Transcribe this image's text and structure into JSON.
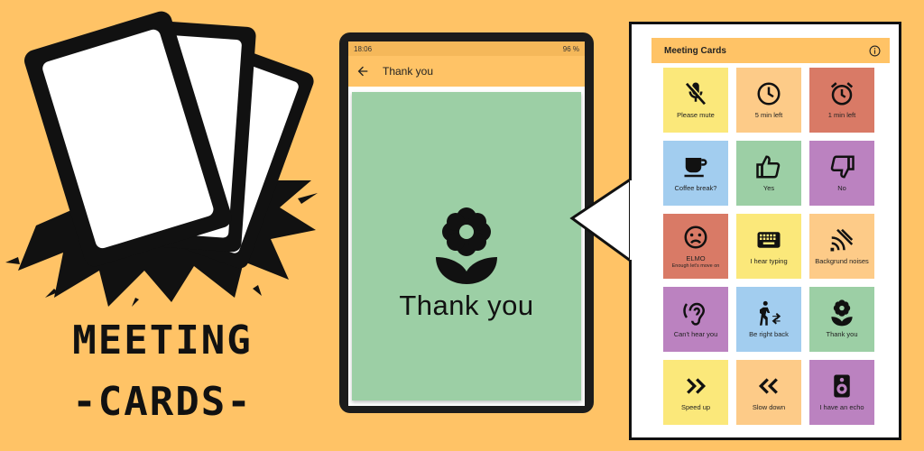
{
  "logo": {
    "line1": "MEETING",
    "line2": "-CARDS-"
  },
  "phone": {
    "status_time": "18:06",
    "status_battery": "96 %",
    "title": "Thank you",
    "card": {
      "label": "Thank you",
      "icon": "flower-icon",
      "color": "#9ccfa5"
    }
  },
  "tablet": {
    "title": "Meeting Cards",
    "cards": [
      {
        "label": "Please mute",
        "icon": "mic-off-icon",
        "color": "#fbe87a"
      },
      {
        "label": "5 min left",
        "icon": "clock-icon",
        "color": "#fdcb88"
      },
      {
        "label": "1 min left",
        "icon": "alarm-icon",
        "color": "#d97a66"
      },
      {
        "label": "Coffee break?",
        "icon": "coffee-icon",
        "color": "#a2cdef"
      },
      {
        "label": "Yes",
        "icon": "thumb-up-icon",
        "color": "#9ccfa5"
      },
      {
        "label": "No",
        "icon": "thumb-down-icon",
        "color": "#bb82c0"
      },
      {
        "label": "ELMO",
        "sub": "Enough let's move on",
        "icon": "sad-face-icon",
        "color": "#d97a66"
      },
      {
        "label": "I hear typing",
        "icon": "keyboard-icon",
        "color": "#fbe87a"
      },
      {
        "label": "Backgrund noises",
        "icon": "noise-icon",
        "color": "#fdcb88"
      },
      {
        "label": "Can't hear you",
        "icon": "ear-icon",
        "color": "#bb82c0"
      },
      {
        "label": "Be right back",
        "icon": "walk-icon",
        "color": "#a2cdef"
      },
      {
        "label": "Thank you",
        "icon": "flower-icon",
        "color": "#9ccfa5"
      },
      {
        "label": "Speed up",
        "icon": "double-right-icon",
        "color": "#fbe87a"
      },
      {
        "label": "Slow down",
        "icon": "double-left-icon",
        "color": "#fdcb88"
      },
      {
        "label": "I have an echo",
        "icon": "speaker-icon",
        "color": "#bb82c0"
      }
    ]
  }
}
